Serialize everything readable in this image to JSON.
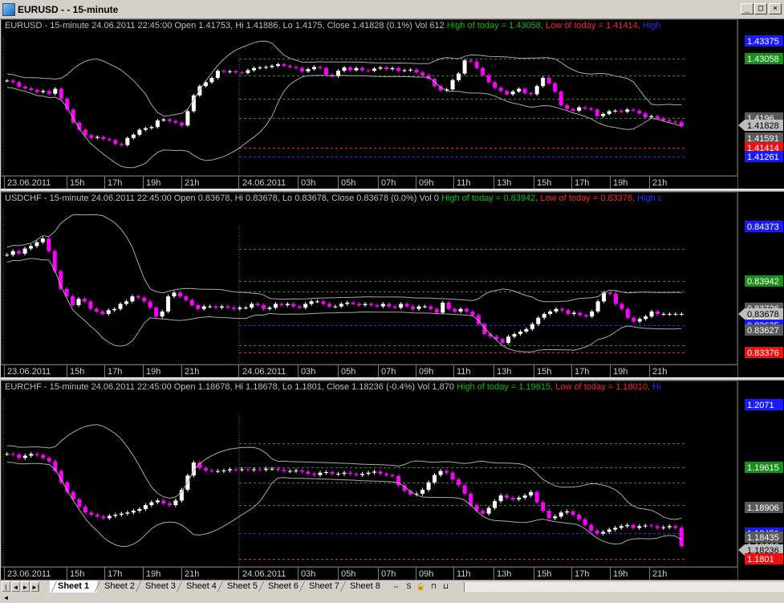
{
  "window": {
    "title": "EURUSD -  - 15-minute",
    "buttons": [
      "_",
      "□",
      "×"
    ]
  },
  "colors": {
    "bull": "#ffffff",
    "bear": "#ff00ff",
    "band": "#a9a9a9",
    "high_line": "#2e8b2e",
    "low_line": "#ff2020",
    "blue_line": "#2a2aff"
  },
  "time_labels": [
    "23.06.2011",
    "15h",
    "17h",
    "19h",
    "21h",
    "24.06.2011",
    "03h",
    "05h",
    "07h",
    "09h",
    "11h",
    "13h",
    "15h",
    "17h",
    "19h",
    "21h"
  ],
  "panes": [
    {
      "symbol": "EURUSD",
      "header": {
        "info": "EURUSD - 15-minute 24.06.2011 22:45:00 Open 1.41753, Hi 1.41886, Lo 1.4175, Close 1.41828 (0.1%) Vol 612",
        "high_text": "High of today = 1.43058,",
        "low_text": "Low of today = 1.41414,",
        "blue_text": "High"
      },
      "y_range": [
        1.4098,
        1.4345
      ],
      "price_labels": [
        {
          "text": "1.43375",
          "value": 1.43375,
          "kind": "blue"
        },
        {
          "text": "1.43058",
          "value": 1.43058,
          "kind": "green"
        },
        {
          "text": "1.4196",
          "value": 1.4196,
          "kind": "gray"
        },
        {
          "text": "1.41828",
          "value": 1.41828,
          "kind": "plain"
        },
        {
          "text": "1.41828",
          "value": 1.41828,
          "kind": "arrow"
        },
        {
          "text": "1.41591",
          "value": 1.41591,
          "kind": "gray"
        },
        {
          "text": "1.41414",
          "value": 1.41414,
          "kind": "red"
        },
        {
          "text": "1.41261",
          "value": 1.41261,
          "kind": "blue"
        }
      ],
      "levels": [
        {
          "value": 1.43058,
          "kind": "high"
        },
        {
          "value": 1.4275,
          "kind": "green"
        },
        {
          "value": 1.4232,
          "kind": "green"
        },
        {
          "value": 1.4196,
          "kind": "green"
        },
        {
          "value": 1.41414,
          "kind": "low"
        },
        {
          "value": 1.41261,
          "kind": "blue"
        }
      ],
      "closes": [
        1.4265,
        1.4262,
        1.4254,
        1.4251,
        1.4248,
        1.4244,
        1.4246,
        1.4241,
        1.425,
        1.4232,
        1.4212,
        1.4188,
        1.4175,
        1.4165,
        1.416,
        1.4162,
        1.4158,
        1.4156,
        1.4149,
        1.4147,
        1.416,
        1.4166,
        1.4175,
        1.4178,
        1.418,
        1.4192,
        1.4194,
        1.4191,
        1.4188,
        1.4183,
        1.4209,
        1.4238,
        1.4255,
        1.4262,
        1.427,
        1.4283,
        1.4281,
        1.4282,
        1.428,
        1.4279,
        1.4284,
        1.4288,
        1.4289,
        1.429,
        1.4292,
        1.4295,
        1.4292,
        1.429,
        1.4288,
        1.4282,
        1.4286,
        1.429,
        1.4288,
        1.4276,
        1.4273,
        1.4283,
        1.4289,
        1.4284,
        1.4288,
        1.4284,
        1.4283,
        1.4287,
        1.4289,
        1.4286,
        1.4288,
        1.4283,
        1.4284,
        1.4285,
        1.428,
        1.4275,
        1.4268,
        1.4255,
        1.4247,
        1.4249,
        1.4266,
        1.4278,
        1.4302,
        1.43,
        1.4288,
        1.4275,
        1.4262,
        1.4252,
        1.4246,
        1.424,
        1.4245,
        1.425,
        1.4242,
        1.424,
        1.4255,
        1.427,
        1.426,
        1.4245,
        1.422,
        1.4213,
        1.421,
        1.4216,
        1.4214,
        1.4212,
        1.42,
        1.4204,
        1.4209,
        1.421,
        1.4208,
        1.4212,
        1.421,
        1.4205,
        1.4198,
        1.42,
        1.4196,
        1.4192,
        1.419,
        1.4189,
        1.4182
      ]
    },
    {
      "symbol": "USDCHF",
      "header": {
        "info": "USDCHF - 15-minute 24.06.2011 22:45:00 Open 0.83678, Hi 0.83678, Lo 0.83678, Close 0.83678 (0.0%) Vol 0",
        "high_text": "High of today = 0.83942,",
        "low_text": "Low of today = 0.83376,",
        "blue_text": "High c"
      },
      "y_range": [
        0.8331,
        0.8451
      ],
      "price_labels": [
        {
          "text": "0.84373",
          "value": 0.84373,
          "kind": "blue"
        },
        {
          "text": "0.83942",
          "value": 0.83942,
          "kind": "green"
        },
        {
          "text": "0.83726",
          "value": 0.83726,
          "kind": "gray"
        },
        {
          "text": "0.83678",
          "value": 0.83678,
          "kind": "arrow"
        },
        {
          "text": "0.83678",
          "value": 0.83628,
          "kind": "plain"
        },
        {
          "text": "0.83635",
          "value": 0.8359,
          "kind": "blue"
        },
        {
          "text": "0.83627",
          "value": 0.8355,
          "kind": "gray"
        },
        {
          "text": "0.83376",
          "value": 0.83376,
          "kind": "red"
        }
      ],
      "levels": [
        {
          "value": 0.83942,
          "kind": "high"
        },
        {
          "value": 0.842,
          "kind": "green"
        },
        {
          "value": 0.8386,
          "kind": "green"
        },
        {
          "value": 0.8359,
          "kind": "blue"
        },
        {
          "value": 0.8343,
          "kind": "green"
        },
        {
          "value": 0.83376,
          "kind": "low"
        }
      ],
      "closes": [
        0.8415,
        0.8418,
        0.8416,
        0.842,
        0.8422,
        0.8425,
        0.8428,
        0.8418,
        0.8402,
        0.8388,
        0.8382,
        0.8375,
        0.838,
        0.8378,
        0.8372,
        0.837,
        0.8368,
        0.8371,
        0.8372,
        0.8376,
        0.8378,
        0.8382,
        0.8381,
        0.8378,
        0.8373,
        0.8366,
        0.837,
        0.8382,
        0.8385,
        0.8382,
        0.8379,
        0.8375,
        0.8372,
        0.8374,
        0.8374,
        0.8373,
        0.8374,
        0.8373,
        0.8372,
        0.8373,
        0.8373,
        0.8376,
        0.8375,
        0.8372,
        0.8373,
        0.8376,
        0.8375,
        0.8376,
        0.8374,
        0.8373,
        0.8376,
        0.8378,
        0.8378,
        0.8376,
        0.8374,
        0.8374,
        0.8376,
        0.8377,
        0.8376,
        0.8375,
        0.8376,
        0.8375,
        0.8374,
        0.8376,
        0.8374,
        0.8373,
        0.8376,
        0.8374,
        0.8372,
        0.8374,
        0.8374,
        0.8372,
        0.8369,
        0.8377,
        0.8372,
        0.837,
        0.8372,
        0.837,
        0.8367,
        0.836,
        0.8352,
        0.835,
        0.8348,
        0.8345,
        0.835,
        0.8352,
        0.8354,
        0.8356,
        0.836,
        0.8365,
        0.8368,
        0.837,
        0.8372,
        0.8371,
        0.8368,
        0.8369,
        0.8367,
        0.8366,
        0.837,
        0.8378,
        0.8385,
        0.8384,
        0.8376,
        0.8372,
        0.8365,
        0.8362,
        0.8364,
        0.8366,
        0.837,
        0.8368,
        0.8368,
        0.8368,
        0.8368,
        0.8368
      ]
    },
    {
      "symbol": "EURCHF",
      "header": {
        "info": "EURCHF - 15-minute 24.06.2011 22:45:00 Open 1.18678, Hi 1.18678, Lo 1.1801, Close 1.18236 (-0.4%) Vol 1,870",
        "high_text": "High of today = 1.19615,",
        "low_text": "Low of today = 1.18010,",
        "blue_text": "Hi"
      },
      "y_range": [
        1.1792,
        1.2083
      ],
      "price_labels": [
        {
          "text": "1.2071",
          "value": 1.2071,
          "kind": "blue"
        },
        {
          "text": "1.19615",
          "value": 1.19615,
          "kind": "green"
        },
        {
          "text": "1.18906",
          "value": 1.18906,
          "kind": "gray"
        },
        {
          "text": "1.18451",
          "value": 1.18451,
          "kind": "blue"
        },
        {
          "text": "1.18435",
          "value": 1.18385,
          "kind": "gray"
        },
        {
          "text": "1.18236",
          "value": 1.18236,
          "kind": "plain"
        },
        {
          "text": "1.18236",
          "value": 1.18166,
          "kind": "arrow"
        },
        {
          "text": "1.1801",
          "value": 1.1801,
          "kind": "red"
        }
      ],
      "levels": [
        {
          "value": 1.19615,
          "kind": "high"
        },
        {
          "value": 1.2004,
          "kind": "green"
        },
        {
          "value": 1.1934,
          "kind": "green"
        },
        {
          "value": 1.1895,
          "kind": "green"
        },
        {
          "value": 1.18451,
          "kind": "blue"
        },
        {
          "value": 1.1801,
          "kind": "low"
        }
      ],
      "closes": [
        1.1985,
        1.1984,
        1.1978,
        1.1982,
        1.1985,
        1.1983,
        1.1978,
        1.1972,
        1.1955,
        1.1935,
        1.1918,
        1.1905,
        1.1892,
        1.1882,
        1.1878,
        1.1875,
        1.1872,
        1.1876,
        1.1878,
        1.188,
        1.1882,
        1.1885,
        1.1888,
        1.1895,
        1.19,
        1.1903,
        1.1898,
        1.1895,
        1.1903,
        1.1922,
        1.1947,
        1.197,
        1.196,
        1.1956,
        1.1955,
        1.1955,
        1.1956,
        1.1958,
        1.1957,
        1.1958,
        1.1957,
        1.1958,
        1.1957,
        1.1959,
        1.1959,
        1.1957,
        1.1955,
        1.1955,
        1.1956,
        1.1954,
        1.195,
        1.1948,
        1.1952,
        1.1953,
        1.195,
        1.195,
        1.1952,
        1.195,
        1.1948,
        1.195,
        1.1952,
        1.1954,
        1.195,
        1.1948,
        1.1946,
        1.193,
        1.192,
        1.1914,
        1.1915,
        1.1922,
        1.1935,
        1.1948,
        1.1955,
        1.1952,
        1.194,
        1.193,
        1.1915,
        1.1895,
        1.1885,
        1.188,
        1.189,
        1.1902,
        1.1912,
        1.1908,
        1.1905,
        1.1908,
        1.1912,
        1.1918,
        1.19,
        1.1885,
        1.1872,
        1.1875,
        1.1882,
        1.1884,
        1.1878,
        1.187,
        1.186,
        1.185,
        1.1845,
        1.1848,
        1.1852,
        1.1855,
        1.1858,
        1.186,
        1.1855,
        1.1858,
        1.1859,
        1.1858,
        1.1855,
        1.1856,
        1.1858,
        1.1855,
        1.1823
      ]
    }
  ],
  "sheets": {
    "tabs": [
      "Sheet 1",
      "Sheet 2",
      "Sheet 3",
      "Sheet 4",
      "Sheet 5",
      "Sheet 6",
      "Sheet 7",
      "Sheet 8"
    ],
    "active": "Sheet 1",
    "nav": [
      "|◄",
      "◄",
      "►",
      "►|"
    ],
    "tools": [
      "⇔",
      "S",
      "🔒",
      "⊓",
      "⊔"
    ]
  }
}
